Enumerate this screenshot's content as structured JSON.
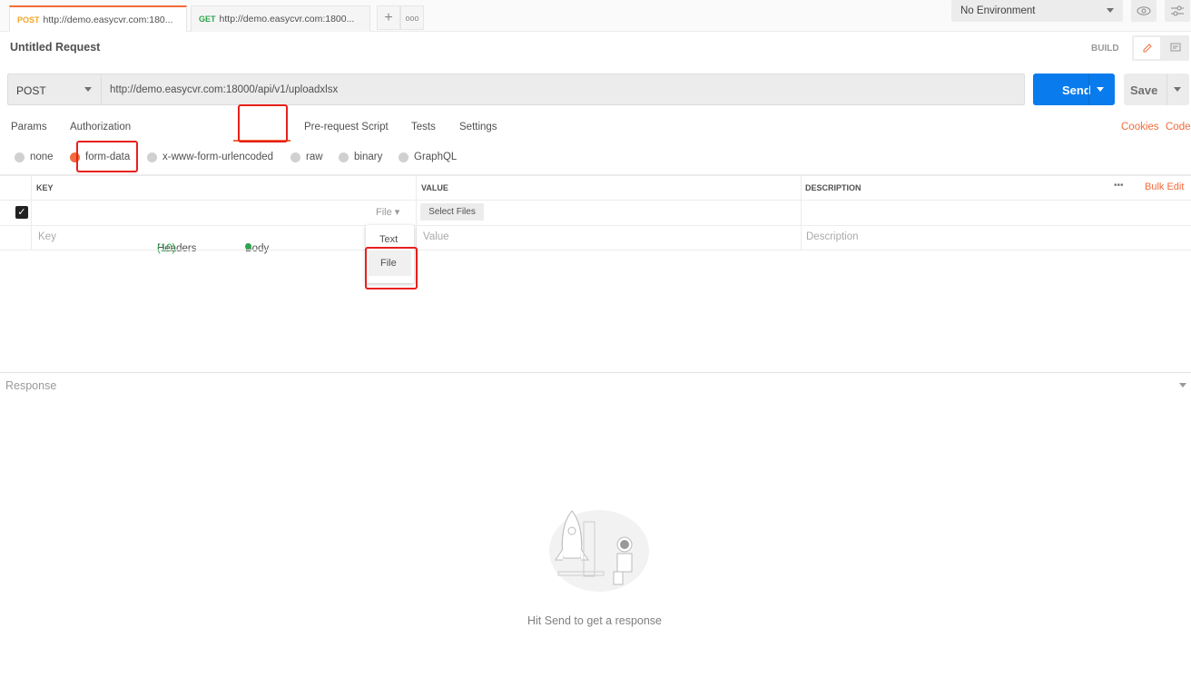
{
  "tabs": [
    {
      "method": "POST",
      "url": "http://demo.easycvr.com:180...",
      "active": true
    },
    {
      "method": "GET",
      "url": "http://demo.easycvr.com:1800...",
      "active": false
    }
  ],
  "environment": {
    "selected": "No Environment"
  },
  "request": {
    "title": "Untitled Request",
    "build_label": "BUILD",
    "method": "POST",
    "url": "http://demo.easycvr.com:18000/api/v1/uploadxlsx",
    "send_label": "Send",
    "save_label": "Save"
  },
  "subtabs": {
    "params": "Params",
    "authorization": "Authorization",
    "headers": "Headers",
    "headers_count": "(10)",
    "body": "Body",
    "prerequest": "Pre-request Script",
    "tests": "Tests",
    "settings": "Settings",
    "cookies": "Cookies",
    "code": "Code"
  },
  "body_types": [
    "none",
    "form-data",
    "x-www-form-urlencoded",
    "raw",
    "binary",
    "GraphQL"
  ],
  "body_selected": "form-data",
  "table": {
    "headers": {
      "key": "KEY",
      "value": "VALUE",
      "description": "DESCRIPTION",
      "more": "•••",
      "bulk_edit": "Bulk Edit"
    },
    "row1": {
      "checked": true,
      "type": "File",
      "select_files": "Select Files"
    },
    "placeholders": {
      "key": "Key",
      "value": "Value",
      "description": "Description"
    }
  },
  "type_menu": [
    "Text",
    "File"
  ],
  "response": {
    "label": "Response",
    "empty_message": "Hit Send to get a response"
  },
  "colors": {
    "accent": "#f26b3a",
    "send": "#097bed",
    "highlight": "#e8201b"
  }
}
